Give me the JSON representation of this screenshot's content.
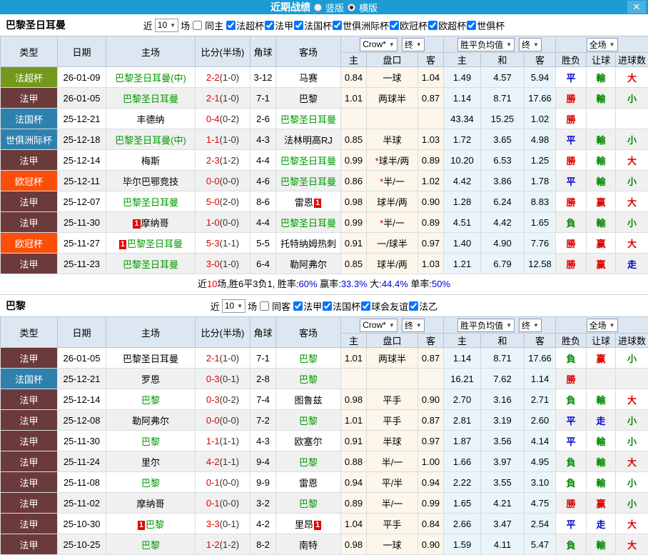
{
  "titlebar": {
    "title": "近期战绩",
    "vertical_label": "竖版",
    "horizontal_label": "横版",
    "close_label": "✕",
    "bar_color": "#1d9bd5"
  },
  "labels": {
    "near": "近",
    "matches": "场",
    "badge_text": "1"
  },
  "header": {
    "cols": [
      "类型",
      "日期",
      "主场",
      "比分(半场)",
      "角球",
      "客场"
    ],
    "sub": [
      "主",
      "盘口",
      "客",
      "主",
      "和",
      "客",
      "胜负",
      "让球",
      "进球数"
    ],
    "crow_dd": "Crow*",
    "final_dd1": "终",
    "avg_dd": "胜平负均值",
    "final_dd2": "终",
    "fulltime_dd": "全场"
  },
  "type_colors": {
    "法超杯": "#72991c",
    "法甲": "#6b3a3a",
    "法国杯": "#2f81ad",
    "世俱洲际杯": "#2f81ad",
    "欧冠杯": "#fb4e09"
  },
  "result_colors": {
    "勝": "#dd0000",
    "負": "#008800",
    "平": "#0000cc",
    "赢": "#dd0000",
    "輸": "#008800",
    "走": "#0000cc",
    "大": "#dd0000",
    "小": "#008800"
  },
  "sections": [
    {
      "team": "巴黎圣日耳曼",
      "near_value": "10",
      "same_label": "同主",
      "same_checked": false,
      "leagues": [
        "法超杯",
        "法甲",
        "法国杯",
        "世俱洲际杯",
        "欧冠杯",
        "欧超杯",
        "世俱杯"
      ],
      "rows": [
        {
          "tp": "法超杯",
          "dt": "26-01-09",
          "hm": "巴黎圣日耳曼(中)",
          "hg": true,
          "hb": false,
          "sc": "2-2",
          "hf": "(1-0)",
          "cn": "3-12",
          "aw": "马赛",
          "ag": false,
          "ab": false,
          "ch": "0.84",
          "pk": "一球",
          "ca": "1.04",
          "ah": "1.49",
          "ad": "4.57",
          "aa": "5.94",
          "r": [
            "平",
            "輸",
            "大"
          ]
        },
        {
          "tp": "法甲",
          "dt": "26-01-05",
          "hm": "巴黎圣日耳曼",
          "hg": true,
          "hb": false,
          "sc": "2-1",
          "hf": "(1-0)",
          "cn": "7-1",
          "aw": "巴黎",
          "ag": false,
          "ab": false,
          "ch": "1.01",
          "pk": "两球半",
          "ca": "0.87",
          "ah": "1.14",
          "ad": "8.71",
          "aa": "17.66",
          "r": [
            "勝",
            "輸",
            "小"
          ]
        },
        {
          "tp": "法国杯",
          "dt": "25-12-21",
          "hm": "丰德纳",
          "hg": false,
          "hb": false,
          "sc": "0-4",
          "hf": "(0-2)",
          "cn": "2-6",
          "aw": "巴黎圣日耳曼",
          "ag": true,
          "ab": false,
          "ch": "",
          "pk": "",
          "ca": "",
          "ah": "43.34",
          "ad": "15.25",
          "aa": "1.02",
          "r": [
            "勝",
            "",
            ""
          ]
        },
        {
          "tp": "世俱洲际杯",
          "dt": "25-12-18",
          "hm": "巴黎圣日耳曼(中)",
          "hg": true,
          "hb": false,
          "sc": "1-1",
          "hf": "(1-0)",
          "cn": "4-3",
          "aw": "法林明高RJ",
          "ag": false,
          "ab": false,
          "ch": "0.85",
          "pk": "半球",
          "ca": "1.03",
          "ah": "1.72",
          "ad": "3.65",
          "aa": "4.98",
          "r": [
            "平",
            "輸",
            "小"
          ]
        },
        {
          "tp": "法甲",
          "dt": "25-12-14",
          "hm": "梅斯",
          "hg": false,
          "hb": false,
          "sc": "2-3",
          "hf": "(1-2)",
          "cn": "4-4",
          "aw": "巴黎圣日耳曼",
          "ag": true,
          "ab": false,
          "ch": "0.99",
          "pk": "*球半/两",
          "ca": "0.89",
          "ah": "10.20",
          "ad": "6.53",
          "aa": "1.25",
          "r": [
            "勝",
            "輸",
            "大"
          ]
        },
        {
          "tp": "欧冠杯",
          "dt": "25-12-11",
          "hm": "毕尔巴鄂竞技",
          "hg": false,
          "hb": false,
          "sc": "0-0",
          "hf": "(0-0)",
          "cn": "4-6",
          "aw": "巴黎圣日耳曼",
          "ag": true,
          "ab": false,
          "ch": "0.86",
          "pk": "*半/一",
          "ca": "1.02",
          "ah": "4.42",
          "ad": "3.86",
          "aa": "1.78",
          "r": [
            "平",
            "輸",
            "小"
          ]
        },
        {
          "tp": "法甲",
          "dt": "25-12-07",
          "hm": "巴黎圣日耳曼",
          "hg": true,
          "hb": false,
          "sc": "5-0",
          "hf": "(2-0)",
          "cn": "8-6",
          "aw": "雷恩",
          "ag": false,
          "ab": true,
          "ch": "0.98",
          "pk": "球半/两",
          "ca": "0.90",
          "ah": "1.28",
          "ad": "6.24",
          "aa": "8.83",
          "r": [
            "勝",
            "赢",
            "大"
          ]
        },
        {
          "tp": "法甲",
          "dt": "25-11-30",
          "hm": "摩纳哥",
          "hg": false,
          "hb": true,
          "sc": "1-0",
          "hf": "(0-0)",
          "cn": "4-4",
          "aw": "巴黎圣日耳曼",
          "ag": true,
          "ab": false,
          "ch": "0.99",
          "pk": "*半/一",
          "ca": "0.89",
          "ah": "4.51",
          "ad": "4.42",
          "aa": "1.65",
          "r": [
            "負",
            "輸",
            "小"
          ]
        },
        {
          "tp": "欧冠杯",
          "dt": "25-11-27",
          "hm": "巴黎圣日耳曼",
          "hg": true,
          "hb": true,
          "sc": "5-3",
          "hf": "(1-1)",
          "cn": "5-5",
          "aw": "托特纳姆热刺",
          "ag": false,
          "ab": false,
          "ch": "0.91",
          "pk": "一/球半",
          "ca": "0.97",
          "ah": "1.40",
          "ad": "4.90",
          "aa": "7.76",
          "r": [
            "勝",
            "赢",
            "大"
          ]
        },
        {
          "tp": "法甲",
          "dt": "25-11-23",
          "hm": "巴黎圣日耳曼",
          "hg": true,
          "hb": false,
          "sc": "3-0",
          "hf": "(1-0)",
          "cn": "6-4",
          "aw": "勒阿弗尔",
          "ag": false,
          "ab": false,
          "ch": "0.85",
          "pk": "球半/两",
          "ca": "1.03",
          "ah": "1.21",
          "ad": "6.79",
          "aa": "12.58",
          "r": [
            "勝",
            "赢",
            "走"
          ]
        }
      ],
      "summary": [
        {
          "t": "近",
          "c": ""
        },
        {
          "t": "10",
          "c": "red"
        },
        {
          "t": "场,胜6平3负1, 胜率:",
          "c": ""
        },
        {
          "t": "60%",
          "c": "blue"
        },
        {
          "t": " 赢率:",
          "c": ""
        },
        {
          "t": "33.3%",
          "c": "blue"
        },
        {
          "t": " 大:",
          "c": ""
        },
        {
          "t": "44.4%",
          "c": "blue"
        },
        {
          "t": " 单率:",
          "c": ""
        },
        {
          "t": "50%",
          "c": "blue"
        }
      ]
    },
    {
      "team": "巴黎",
      "near_value": "10",
      "same_label": "同客",
      "same_checked": false,
      "leagues": [
        "法甲",
        "法国杯",
        "球会友谊",
        "法乙"
      ],
      "rows": [
        {
          "tp": "法甲",
          "dt": "26-01-05",
          "hm": "巴黎圣日耳曼",
          "hg": false,
          "hb": false,
          "sc": "2-1",
          "hf": "(1-0)",
          "cn": "7-1",
          "aw": "巴黎",
          "ag": true,
          "ab": false,
          "ch": "1.01",
          "pk": "两球半",
          "ca": "0.87",
          "ah": "1.14",
          "ad": "8.71",
          "aa": "17.66",
          "r": [
            "負",
            "赢",
            "小"
          ]
        },
        {
          "tp": "法国杯",
          "dt": "25-12-21",
          "hm": "罗恩",
          "hg": false,
          "hb": false,
          "sc": "0-3",
          "hf": "(0-1)",
          "cn": "2-8",
          "aw": "巴黎",
          "ag": true,
          "ab": false,
          "ch": "",
          "pk": "",
          "ca": "",
          "ah": "16.21",
          "ad": "7.62",
          "aa": "1.14",
          "r": [
            "勝",
            "",
            ""
          ]
        },
        {
          "tp": "法甲",
          "dt": "25-12-14",
          "hm": "巴黎",
          "hg": true,
          "hb": false,
          "sc": "0-3",
          "hf": "(0-2)",
          "cn": "7-4",
          "aw": "图鲁兹",
          "ag": false,
          "ab": false,
          "ch": "0.98",
          "pk": "平手",
          "ca": "0.90",
          "ah": "2.70",
          "ad": "3.16",
          "aa": "2.71",
          "r": [
            "負",
            "輸",
            "大"
          ]
        },
        {
          "tp": "法甲",
          "dt": "25-12-08",
          "hm": "勒阿弗尔",
          "hg": false,
          "hb": false,
          "sc": "0-0",
          "hf": "(0-0)",
          "cn": "7-2",
          "aw": "巴黎",
          "ag": true,
          "ab": false,
          "ch": "1.01",
          "pk": "平手",
          "ca": "0.87",
          "ah": "2.81",
          "ad": "3.19",
          "aa": "2.60",
          "r": [
            "平",
            "走",
            "小"
          ]
        },
        {
          "tp": "法甲",
          "dt": "25-11-30",
          "hm": "巴黎",
          "hg": true,
          "hb": false,
          "sc": "1-1",
          "hf": "(1-1)",
          "cn": "4-3",
          "aw": "欧塞尔",
          "ag": false,
          "ab": false,
          "ch": "0.91",
          "pk": "半球",
          "ca": "0.97",
          "ah": "1.87",
          "ad": "3.56",
          "aa": "4.14",
          "r": [
            "平",
            "輸",
            "小"
          ]
        },
        {
          "tp": "法甲",
          "dt": "25-11-24",
          "hm": "里尔",
          "hg": false,
          "hb": false,
          "sc": "4-2",
          "hf": "(1-1)",
          "cn": "9-4",
          "aw": "巴黎",
          "ag": true,
          "ab": false,
          "ch": "0.88",
          "pk": "半/一",
          "ca": "1.00",
          "ah": "1.66",
          "ad": "3.97",
          "aa": "4.95",
          "r": [
            "負",
            "輸",
            "大"
          ]
        },
        {
          "tp": "法甲",
          "dt": "25-11-08",
          "hm": "巴黎",
          "hg": true,
          "hb": false,
          "sc": "0-1",
          "hf": "(0-0)",
          "cn": "9-9",
          "aw": "雷恩",
          "ag": false,
          "ab": false,
          "ch": "0.94",
          "pk": "平/半",
          "ca": "0.94",
          "ah": "2.22",
          "ad": "3.55",
          "aa": "3.10",
          "r": [
            "負",
            "輸",
            "小"
          ]
        },
        {
          "tp": "法甲",
          "dt": "25-11-02",
          "hm": "摩纳哥",
          "hg": false,
          "hb": false,
          "sc": "0-1",
          "hf": "(0-0)",
          "cn": "3-2",
          "aw": "巴黎",
          "ag": true,
          "ab": false,
          "ch": "0.89",
          "pk": "半/一",
          "ca": "0.99",
          "ah": "1.65",
          "ad": "4.21",
          "aa": "4.75",
          "r": [
            "勝",
            "赢",
            "小"
          ]
        },
        {
          "tp": "法甲",
          "dt": "25-10-30",
          "hm": "巴黎",
          "hg": true,
          "hb": true,
          "sc": "3-3",
          "hf": "(0-1)",
          "cn": "4-2",
          "aw": "里昂",
          "ag": false,
          "ab": true,
          "ch": "1.04",
          "pk": "平手",
          "ca": "0.84",
          "ah": "2.66",
          "ad": "3.47",
          "aa": "2.54",
          "r": [
            "平",
            "走",
            "大"
          ]
        },
        {
          "tp": "法甲",
          "dt": "25-10-25",
          "hm": "巴黎",
          "hg": true,
          "hb": false,
          "sc": "1-2",
          "hf": "(1-2)",
          "cn": "8-2",
          "aw": "南特",
          "ag": false,
          "ab": false,
          "ch": "0.98",
          "pk": "一球",
          "ca": "0.90",
          "ah": "1.59",
          "ad": "4.11",
          "aa": "5.47",
          "r": [
            "負",
            "輸",
            "大"
          ]
        }
      ],
      "summary": null
    }
  ]
}
